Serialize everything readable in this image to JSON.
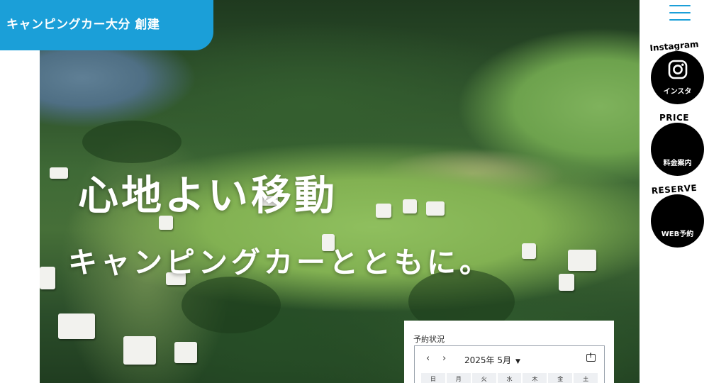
{
  "brand": {
    "name": "キャンピングカー大分 創建"
  },
  "hero": {
    "headline": "心地よい移動",
    "subheadline": "キャンピングカーとともに。"
  },
  "sidebar": {
    "menu_icon": "hamburger-menu-icon",
    "instagram": {
      "caption": "Instagram",
      "label": "インスタ",
      "icon": "instagram-icon"
    },
    "price": {
      "caption": "PRICE",
      "label": "料金案内"
    },
    "reserve": {
      "caption": "RESERVE",
      "label": "WEB予約"
    }
  },
  "reservation": {
    "title": "予約状況",
    "prev": "‹",
    "next": "›",
    "month": "2025年 5月",
    "weekdays": [
      "日",
      "月",
      "火",
      "水",
      "木",
      "金",
      "土"
    ]
  },
  "colors": {
    "accent": "#1b9fd8",
    "button": "#000000"
  }
}
